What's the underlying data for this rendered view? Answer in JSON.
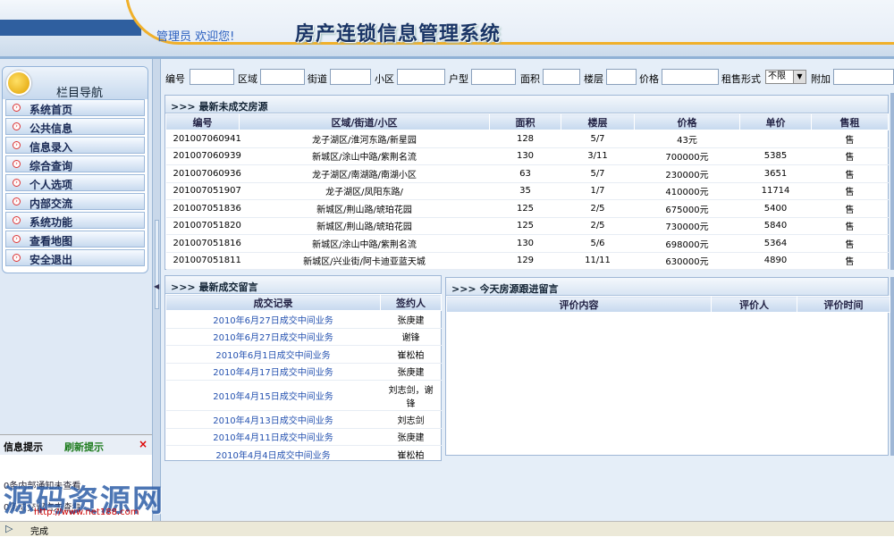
{
  "header": {
    "greeting": "管理员  欢迎您!",
    "system_title": "房产连锁信息管理系统"
  },
  "nav": {
    "title": "栏目导航",
    "items": [
      {
        "label": "系统首页"
      },
      {
        "label": "公共信息"
      },
      {
        "label": "信息录入"
      },
      {
        "label": "综合查询"
      },
      {
        "label": "个人选项"
      },
      {
        "label": "内部交流"
      },
      {
        "label": "系统功能"
      },
      {
        "label": "查看地图"
      },
      {
        "label": "安全退出"
      }
    ]
  },
  "notice": {
    "title": "信息提示",
    "refresh": "刷新提示",
    "close": "×",
    "line1": "0条内部通知未查看",
    "line2": "0条成交留言未查看"
  },
  "search": {
    "labels": [
      "编号",
      "区域",
      "街道",
      "小区",
      "户型",
      "面积",
      "楼层",
      "价格",
      "租售形式",
      "附加"
    ],
    "rent_selected": "不限"
  },
  "recent_listings": {
    "title": ">>> 最新未成交房源",
    "columns": [
      "编号",
      "区域/街道/小区",
      "面积",
      "楼层",
      "价格",
      "单价",
      "售租"
    ],
    "rows": [
      [
        "201007060941",
        "龙子湖区/淮河东路/新星园",
        "128",
        "5/7",
        "43元",
        "",
        "售"
      ],
      [
        "201007060939",
        "新城区/涂山中路/紫荆名流",
        "130",
        "3/11",
        "700000元",
        "5385",
        "售"
      ],
      [
        "201007060936",
        "龙子湖区/南湖路/南湖小区",
        "63",
        "5/7",
        "230000元",
        "3651",
        "售"
      ],
      [
        "201007051907",
        "龙子湖区/凤阳东路/",
        "35",
        "1/7",
        "410000元",
        "11714",
        "售"
      ],
      [
        "201007051836",
        "新城区/荆山路/琥珀花园",
        "125",
        "2/5",
        "675000元",
        "5400",
        "售"
      ],
      [
        "201007051820",
        "新城区/荆山路/琥珀花园",
        "125",
        "2/5",
        "730000元",
        "5840",
        "售"
      ],
      [
        "201007051816",
        "新城区/涂山中路/紫荆名流",
        "130",
        "5/6",
        "698000元",
        "5364",
        "售"
      ],
      [
        "201007051811",
        "新城区/兴业街/阿卡迪亚蓝天城",
        "129",
        "11/11",
        "630000元",
        "4890",
        "售"
      ]
    ]
  },
  "deal_messages": {
    "title": ">>> 最新成交留言",
    "columns": [
      "成交记录",
      "签约人"
    ],
    "rows": [
      [
        "2010年6月27日成交中间业务",
        "张庚建"
      ],
      [
        "2010年6月27日成交中间业务",
        "谢锋"
      ],
      [
        "2010年6月1日成交中间业务",
        "崔松柏"
      ],
      [
        "2010年4月17日成交中间业务",
        "张庚建"
      ],
      [
        "2010年4月15日成交中间业务",
        "刘志剑，谢锋"
      ],
      [
        "2010年4月13日成交中间业务",
        "刘志剑"
      ],
      [
        "2010年4月11日成交中间业务",
        "张庚建"
      ],
      [
        "2010年4月4日成交中间业务",
        "崔松柏"
      ]
    ]
  },
  "followup": {
    "title": ">>> 今天房源跟进留言",
    "columns": [
      "评价内容",
      "评价人",
      "评价时间"
    ]
  },
  "status": {
    "text": "完成"
  },
  "watermark": {
    "text": "源码资源网",
    "url": "http://www.net188.com"
  }
}
